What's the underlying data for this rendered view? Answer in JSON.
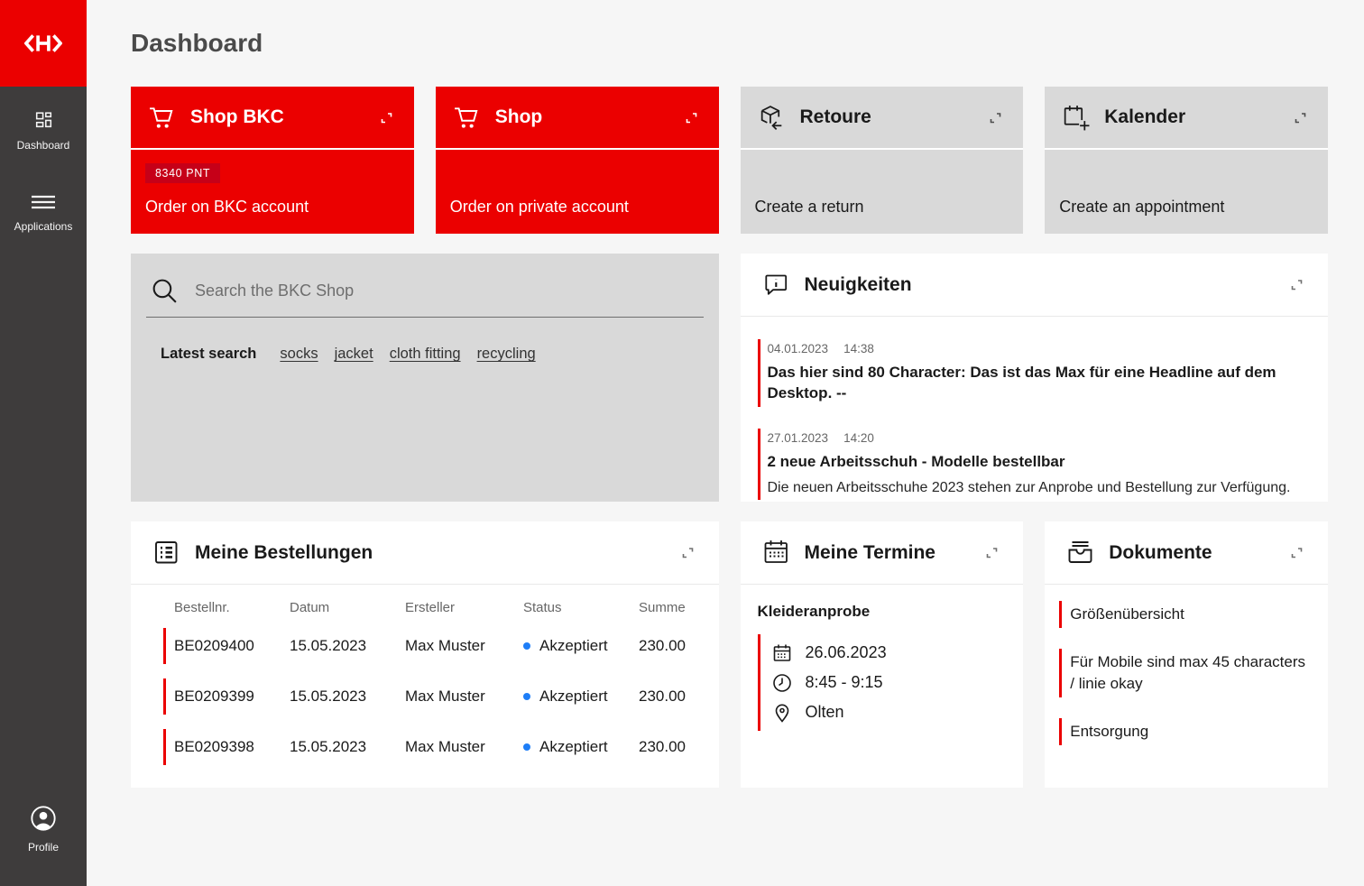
{
  "page_title": "Dashboard",
  "sidebar": {
    "logo_icon": "sbb-double-arrow-icon",
    "items": [
      {
        "label": "Dashboard",
        "icon": "dashboard-grid-icon"
      },
      {
        "label": "Applications",
        "icon": "menu-icon"
      }
    ],
    "profile": {
      "label": "Profile",
      "icon": "user-icon"
    }
  },
  "action_cards": [
    {
      "title": "Shop BKC",
      "icon": "cart-icon",
      "badge": "8340 PNT",
      "text": "Order on BKC account"
    },
    {
      "title": "Shop",
      "icon": "cart-icon",
      "text": "Order on private account"
    },
    {
      "title": "Retoure",
      "icon": "return-package-icon",
      "text": "Create a return"
    },
    {
      "title": "Kalender",
      "icon": "calendar-add-icon",
      "text": "Create an appointment"
    }
  ],
  "search": {
    "placeholder": "Search the BKC Shop",
    "latest_label": "Latest search",
    "terms": [
      "socks",
      "jacket",
      "cloth fitting",
      "recycling"
    ]
  },
  "news": {
    "title": "Neuigkeiten",
    "icon": "speech-bubble-info-icon",
    "items": [
      {
        "date": "04.01.2023",
        "time": "14:38",
        "headline": "Das hier sind 80 Character: Das ist das Max für eine Headline auf dem Desktop. --"
      },
      {
        "date": "27.01.2023",
        "time": "14:20",
        "headline": "2 neue Arbeitsschuh - Modelle bestellbar",
        "body": "Die neuen Arbeitsschuhe 2023 stehen zur Anprobe und Bestellung zur Verfügung."
      }
    ]
  },
  "orders": {
    "title": "Meine Bestellungen",
    "icon": "list-box-icon",
    "columns": [
      "Bestellnr.",
      "Datum",
      "Ersteller",
      "Status",
      "Summe"
    ],
    "rows": [
      {
        "number": "BE0209400",
        "date": "15.05.2023",
        "creator": "Max Muster",
        "status": "Akzeptiert",
        "sum": "230.00"
      },
      {
        "number": "BE0209399",
        "date": "15.05.2023",
        "creator": "Max Muster",
        "status": "Akzeptiert",
        "sum": "230.00"
      },
      {
        "number": "BE0209398",
        "date": "15.05.2023",
        "creator": "Max Muster",
        "status": "Akzeptiert",
        "sum": "230.00"
      }
    ]
  },
  "appointments": {
    "title": "Meine Termine",
    "icon": "calendar-icon",
    "event": "Kleideranprobe",
    "date": "26.06.2023",
    "time": "8:45 - 9:15",
    "location": "Olten"
  },
  "documents": {
    "title": "Dokumente",
    "icon": "document-tray-icon",
    "items": [
      "Größenübersicht",
      "Für Mobile sind max 45 characters / linie okay",
      "Entsorgung"
    ]
  },
  "colors": {
    "brand_red": "#eb0000",
    "badge_red": "#c60018",
    "status_blue": "#1e7ef7",
    "sidebar_bg": "#3e3c3c",
    "panel_gray": "#d9d9d9"
  }
}
